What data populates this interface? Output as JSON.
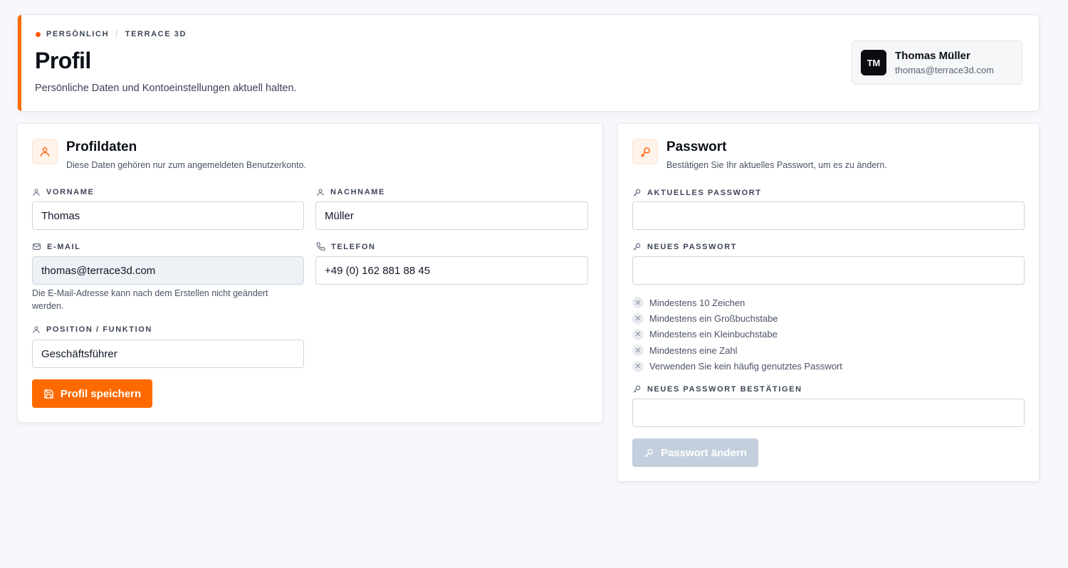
{
  "header": {
    "crumbs": [
      "PERSÖNLICH",
      "TERRACE 3D"
    ],
    "crumb_sep": "/",
    "title": "Profil",
    "subtitle": "Persönliche Daten und Kontoeinstellungen aktuell halten.",
    "accent_color": "#ff6a00"
  },
  "user": {
    "initials": "TM",
    "name": "Thomas Müller",
    "email": "thomas@terrace3d.com"
  },
  "profile": {
    "icon": "user-icon",
    "title": "Profildaten",
    "description": "Diese Daten gehören nur zum angemeldeten Benutzerkonto.",
    "fields": {
      "firstname": {
        "label": "VORNAME",
        "value": "Thomas",
        "icon": "user-icon"
      },
      "lastname": {
        "label": "NACHNAME",
        "value": "Müller",
        "icon": "user-icon"
      },
      "email": {
        "label": "E-MAIL",
        "value": "thomas@terrace3d.com",
        "icon": "mail-icon",
        "hint": "Die E-Mail-Adresse kann nach dem Erstellen nicht geändert werden."
      },
      "phone": {
        "label": "TELEFON",
        "value": "+49 (0) 162 881 88 45",
        "icon": "phone-icon"
      },
      "position": {
        "label": "POSITION / FUNKTION",
        "value": "Geschäftsführer",
        "icon": "user-icon"
      }
    },
    "save_label": "Profil speichern"
  },
  "password": {
    "icon": "key-icon",
    "title": "Passwort",
    "description": "Bestätigen Sie Ihr aktuelles Passwort, um es zu ändern.",
    "current_label": "AKTUELLES PASSWORT",
    "new_label": "NEUES PASSWORT",
    "confirm_label": "NEUES PASSWORT BESTÄTIGEN",
    "rules": [
      "Mindestens 10 Zeichen",
      "Mindestens ein Großbuchstabe",
      "Mindestens ein Kleinbuchstabe",
      "Mindestens eine Zahl",
      "Verwenden Sie kein häufig genutztes Passwort"
    ],
    "submit_label": "Passwort ändern"
  }
}
